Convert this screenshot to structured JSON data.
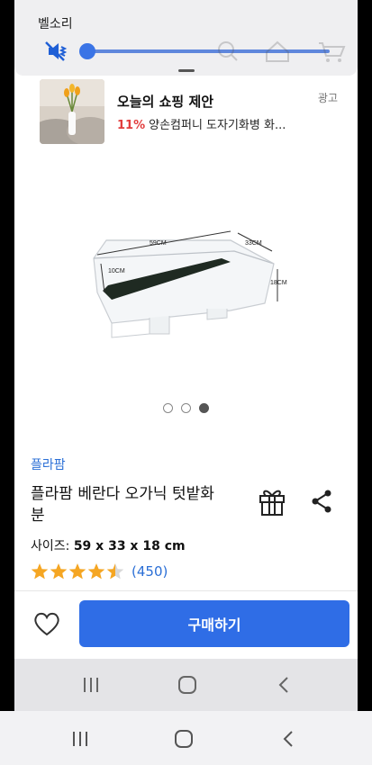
{
  "volume": {
    "label": "벨소리",
    "level": 0.0
  },
  "ad": {
    "title": "오늘의 쇼핑 제안",
    "discount": "11%",
    "description": "양손컴퍼니 도자기화병 화...",
    "badge": "광고"
  },
  "product": {
    "dimension_labels": {
      "length": "59CM",
      "width": "33CM",
      "height": "18CM",
      "depth": "10CM"
    },
    "carousel": {
      "count": 3,
      "active_index": 2
    },
    "brand": "플라팜",
    "title": "플라팜 베란다 오가닉 텃밭화분",
    "spec_label": "사이즈:",
    "spec_value": "59 x 33 x 18 cm",
    "rating": 4.5,
    "rating_count": "(450)"
  },
  "actions": {
    "buy_label": "구매하기"
  },
  "colors": {
    "accent": "#2f6de6",
    "star": "#f5a623",
    "discount": "#e23d3d"
  }
}
